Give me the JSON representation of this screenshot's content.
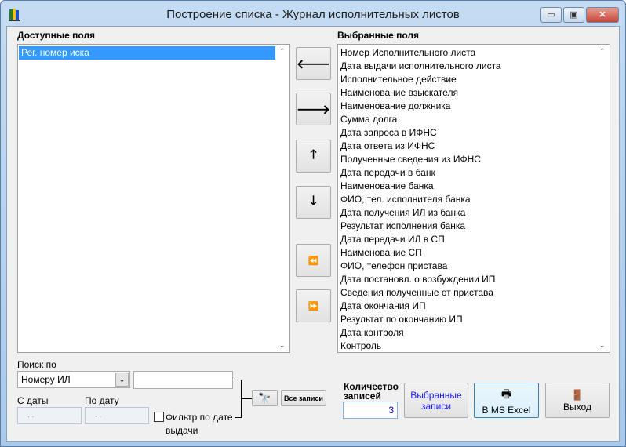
{
  "window": {
    "title": "Построение списка - Журнал исполнительных листов",
    "minimize": "▭",
    "maximize": "▣",
    "close": "✕"
  },
  "available": {
    "label": "Доступные поля",
    "items": [
      "Рег. номер иска"
    ]
  },
  "selected": {
    "label": "Выбранные поля",
    "items": [
      "Номер Исполнительного листа",
      "Дата выдачи исполнительного листа",
      "Исполнительное действие",
      "Наименование взыскателя",
      "Наименование должника",
      "Сумма долга",
      "Дата запроса в ИФНС",
      "Дата ответа из ИФНС",
      "Полученные сведения из ИФНС",
      "Дата передачи в банк",
      "Наименование банка",
      "ФИО, тел. исполнителя банка",
      "Дата получения ИЛ из банка",
      "Результат исполнения банка",
      "Дата передачи ИЛ в СП",
      "Наименование СП",
      "ФИО, телефон пристава",
      "Дата постановл. о возбуждении ИП",
      "Сведения полученные от пристава",
      "Дата окончания ИП",
      "Результат по окончанию ИП",
      "Дата контроля",
      "Контроль"
    ]
  },
  "move_buttons": {
    "left": "🡐",
    "right": "🡒",
    "up": "🡑",
    "down": "🡓",
    "all_left": "⏪",
    "all_right": "⏩"
  },
  "search": {
    "label": "Поиск по",
    "field": "Номеру ИЛ",
    "query": "",
    "date_from_label": "С даты",
    "date_to_label": "По дату",
    "date_from": ". .",
    "date_to": ". .",
    "filter_label": "Фильтр по дате",
    "filter_label2": "выдачи",
    "all_records": "Все записи"
  },
  "count": {
    "label": "Количество",
    "label2": "записей",
    "value": "3"
  },
  "actions": {
    "selected_records": "Выбранные",
    "selected_records2": "записи",
    "excel": "В MS Excel",
    "exit": "Выход"
  }
}
